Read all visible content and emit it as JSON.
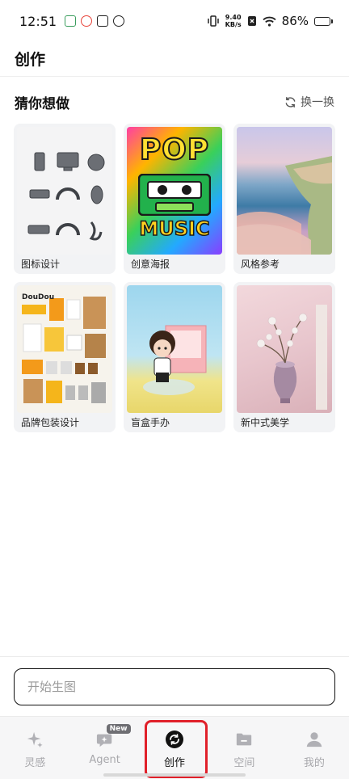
{
  "status": {
    "time": "12:51",
    "net_speed_value": "9.40",
    "net_speed_unit": "KB/s",
    "battery": "86%",
    "battery_level": 0.86
  },
  "header": {
    "title": "创作"
  },
  "section": {
    "title": "猜你想做",
    "refresh_label": "换一换"
  },
  "cards": [
    {
      "label": "图标设计"
    },
    {
      "label": "创意海报",
      "poster_top": "POP",
      "poster_bottom": "MUSIC"
    },
    {
      "label": "风格参考"
    },
    {
      "label": "品牌包装设计",
      "brand": "DouDou"
    },
    {
      "label": "盲盒手办"
    },
    {
      "label": "新中式美学"
    }
  ],
  "prompt": {
    "placeholder": "开始生图",
    "value": ""
  },
  "tabs": [
    {
      "label": "灵感",
      "icon": "sparkle-icon",
      "active": false
    },
    {
      "label": "Agent",
      "icon": "agent-icon",
      "badge": "New",
      "active": false
    },
    {
      "label": "创作",
      "icon": "create-icon",
      "active": true
    },
    {
      "label": "空间",
      "icon": "folder-icon",
      "active": false
    },
    {
      "label": "我的",
      "icon": "person-icon",
      "active": false
    }
  ],
  "colors": {
    "accent": "#111111",
    "highlight": "#e0202a",
    "inactive": "#a8a8ac"
  }
}
